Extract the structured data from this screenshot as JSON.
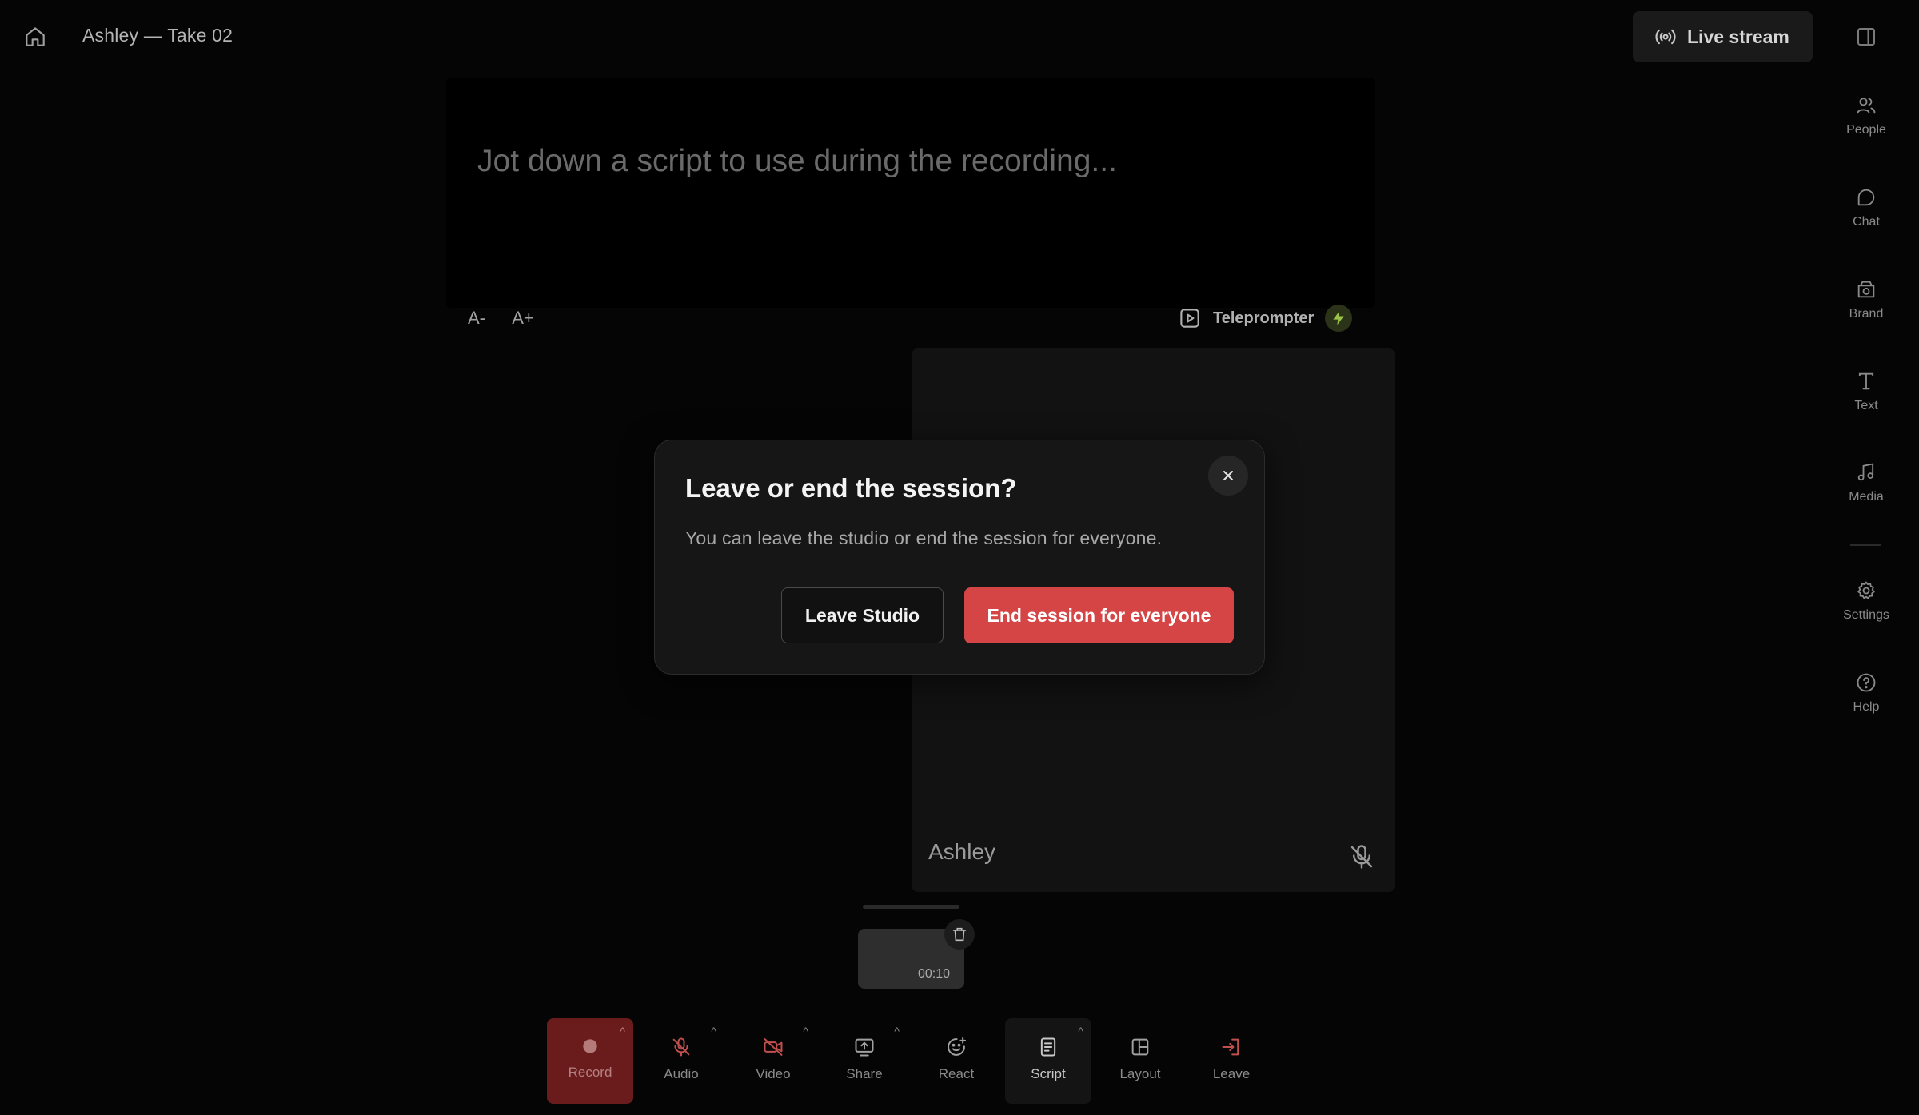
{
  "header": {
    "title": "Ashley — Take 02",
    "live_stream_label": "Live stream"
  },
  "script_editor": {
    "placeholder": "Jot down a script to use during the recording...",
    "font_decrease_label": "A-",
    "font_increase_label": "A+",
    "teleprompter_label": "Teleprompter"
  },
  "video_tile": {
    "participant_name": "Ashley",
    "mic_muted": true
  },
  "clip": {
    "duration": "00:10"
  },
  "toolbar": {
    "items": [
      {
        "label": "Record",
        "icon": "record-icon"
      },
      {
        "label": "Audio",
        "icon": "mic-off-icon"
      },
      {
        "label": "Video",
        "icon": "camera-off-icon"
      },
      {
        "label": "Share",
        "icon": "screen-share-icon"
      },
      {
        "label": "React",
        "icon": "emoji-add-icon"
      },
      {
        "label": "Script",
        "icon": "script-icon"
      },
      {
        "label": "Layout",
        "icon": "layout-icon"
      },
      {
        "label": "Leave",
        "icon": "leave-icon"
      }
    ]
  },
  "sidebar": {
    "items": [
      {
        "label": "People",
        "icon": "people-icon"
      },
      {
        "label": "Chat",
        "icon": "chat-icon"
      },
      {
        "label": "Brand",
        "icon": "brand-icon"
      },
      {
        "label": "Text",
        "icon": "text-icon"
      },
      {
        "label": "Media",
        "icon": "music-note-icon"
      },
      {
        "label": "Settings",
        "icon": "gear-icon"
      },
      {
        "label": "Help",
        "icon": "help-icon"
      }
    ]
  },
  "modal": {
    "title": "Leave or end the session?",
    "description": "You can leave the studio or end the session for everyone.",
    "leave_button": "Leave Studio",
    "end_button": "End session for everyone"
  },
  "colors": {
    "background": "#050505",
    "danger": "#d64545",
    "record_bg": "#6a1b1b",
    "mute_red": "#c0504d"
  }
}
